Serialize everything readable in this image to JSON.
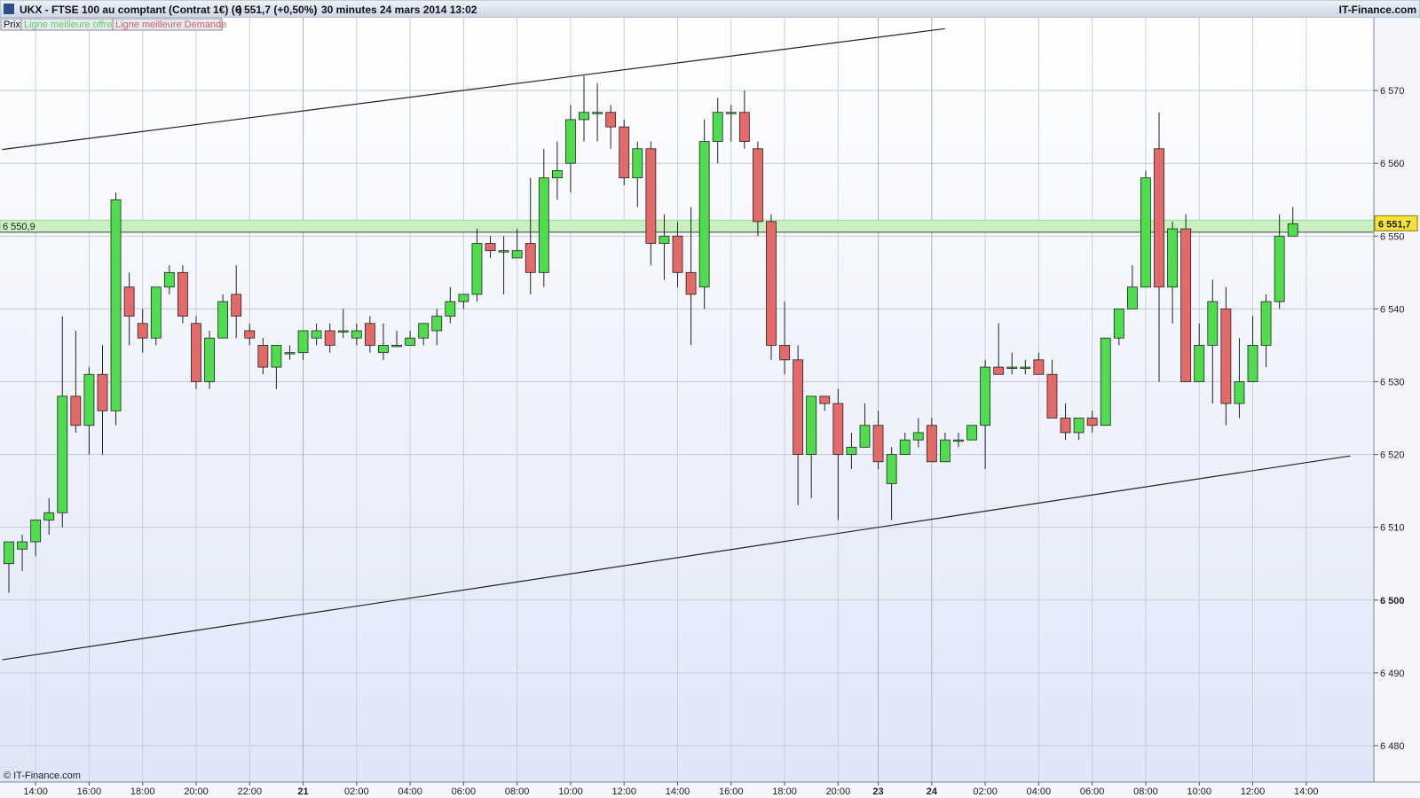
{
  "header": {
    "instrument": "UKX - FTSE 100 au comptant (Contrat 1€) (-)",
    "last": "6 551,7 (+0,50%)",
    "timeframe": "30 minutes",
    "datetime": "24 mars 2014 13:02",
    "brand": "IT-Finance.com"
  },
  "legend": {
    "prix": "Prix",
    "offre": "Ligne meilleure offre",
    "demande": "Ligne meilleure Demande"
  },
  "footer": {
    "copyright": "© IT-Finance.com"
  },
  "colors": {
    "up": "#4fdc4f",
    "down": "#e46a6a",
    "offre_text": "#5ccf5c",
    "demande_text": "#d86060",
    "band": "#c8f0c0",
    "last_tag": "#f5e23a"
  },
  "chart_data": {
    "type": "candlestick",
    "ylim": [
      6475,
      6580
    ],
    "yticks": [
      {
        "value": 6480,
        "label": "6 480"
      },
      {
        "value": 6490,
        "label": "6 490"
      },
      {
        "value": 6500,
        "label": "6 500",
        "bold": true
      },
      {
        "value": 6510,
        "label": "6 510"
      },
      {
        "value": 6520,
        "label": "6 520"
      },
      {
        "value": 6530,
        "label": "6 530"
      },
      {
        "value": 6540,
        "label": "6 540"
      },
      {
        "value": 6550,
        "label": "6 550"
      },
      {
        "value": 6560,
        "label": "6 560"
      },
      {
        "value": 6570,
        "label": "6 570"
      }
    ],
    "xticks": [
      {
        "i": 2,
        "label": "14:00"
      },
      {
        "i": 6,
        "label": "16:00"
      },
      {
        "i": 10,
        "label": "18:00"
      },
      {
        "i": 14,
        "label": "20:00"
      },
      {
        "i": 18,
        "label": "22:00"
      },
      {
        "i": 22,
        "label": "21",
        "bold": true
      },
      {
        "i": 26,
        "label": "02:00"
      },
      {
        "i": 30,
        "label": "04:00"
      },
      {
        "i": 34,
        "label": "06:00"
      },
      {
        "i": 38,
        "label": "08:00"
      },
      {
        "i": 42,
        "label": "10:00"
      },
      {
        "i": 46,
        "label": "12:00"
      },
      {
        "i": 50,
        "label": "14:00"
      },
      {
        "i": 54,
        "label": "16:00"
      },
      {
        "i": 58,
        "label": "18:00"
      },
      {
        "i": 62,
        "label": "20:00"
      },
      {
        "i": 65,
        "label": "23",
        "bold": true
      },
      {
        "i": 69,
        "label": "24",
        "bold": true
      },
      {
        "i": 73,
        "label": "02:00"
      },
      {
        "i": 77,
        "label": "04:00"
      },
      {
        "i": 81,
        "label": "06:00"
      },
      {
        "i": 85,
        "label": "08:00"
      },
      {
        "i": 89,
        "label": "10:00"
      },
      {
        "i": 93,
        "label": "12:00"
      },
      {
        "i": 97,
        "label": "14:00"
      }
    ],
    "price_line": {
      "value": 6550.9,
      "label": "6 550,9"
    },
    "last_price": {
      "value": 6551.7,
      "label": "6 551,7"
    },
    "band": [
      6550.9,
      6552.2
    ],
    "trendlines": [
      {
        "from": [
          -0.5,
          6561.9
        ],
        "to": [
          70,
          6578.5
        ]
      },
      {
        "from": [
          -0.5,
          6491.8
        ],
        "to": [
          100.3,
          6519.8
        ]
      }
    ],
    "candles": [
      [
        6505.0,
        6508.0,
        6501.0,
        6508.0
      ],
      [
        6507.0,
        6509.0,
        6504.0,
        6508.0
      ],
      [
        6508.0,
        6511.0,
        6506.0,
        6511.0
      ],
      [
        6511.0,
        6514.0,
        6509.0,
        6512.0
      ],
      [
        6512.0,
        6539.0,
        6510.0,
        6528.0
      ],
      [
        6528.0,
        6537.0,
        6523.0,
        6524.0
      ],
      [
        6524.0,
        6532.0,
        6520.0,
        6531.0
      ],
      [
        6531.0,
        6535.0,
        6520.0,
        6526.0
      ],
      [
        6526.0,
        6556.0,
        6524.0,
        6555.0
      ],
      [
        6543.0,
        6545.0,
        6535.0,
        6539.0
      ],
      [
        6538.0,
        6540.0,
        6534.0,
        6536.0
      ],
      [
        6536.0,
        6543.0,
        6535.0,
        6543.0
      ],
      [
        6543.0,
        6546.0,
        6542.0,
        6545.0
      ],
      [
        6545.0,
        6546.0,
        6538.0,
        6539.0
      ],
      [
        6538.0,
        6539.0,
        6529.0,
        6530.0
      ],
      [
        6530.0,
        6537.0,
        6529.0,
        6536.0
      ],
      [
        6536.0,
        6542.0,
        6536.0,
        6541.0
      ],
      [
        6542.0,
        6546.0,
        6536.0,
        6539.0
      ],
      [
        6537.0,
        6538.0,
        6535.0,
        6536.0
      ],
      [
        6535.0,
        6536.0,
        6531.0,
        6532.0
      ],
      [
        6532.0,
        6535.0,
        6529.0,
        6535.0
      ],
      [
        6534.0,
        6535.0,
        6533.0,
        6534.0
      ],
      [
        6534.0,
        6537.0,
        6533.0,
        6537.0
      ],
      [
        6536.0,
        6538.0,
        6535.0,
        6537.0
      ],
      [
        6537.0,
        6538.0,
        6534.0,
        6535.0
      ],
      [
        6537.0,
        6540.0,
        6536.0,
        6537.0
      ],
      [
        6536.0,
        6538.0,
        6535.0,
        6537.0
      ],
      [
        6538.0,
        6539.0,
        6534.0,
        6535.0
      ],
      [
        6534.0,
        6538.0,
        6533.0,
        6535.0
      ],
      [
        6535.0,
        6537.0,
        6535.0,
        6535.0
      ],
      [
        6535.0,
        6537.0,
        6535.0,
        6536.0
      ],
      [
        6536.0,
        6538.0,
        6535.0,
        6538.0
      ],
      [
        6537.0,
        6540.0,
        6535.0,
        6539.0
      ],
      [
        6539.0,
        6543.0,
        6538.0,
        6541.0
      ],
      [
        6541.0,
        6542.0,
        6540.0,
        6542.0
      ],
      [
        6542.0,
        6551.0,
        6541.0,
        6549.0
      ],
      [
        6549.0,
        6550.0,
        6547.0,
        6548.0
      ],
      [
        6548.0,
        6550.0,
        6542.0,
        6548.0
      ],
      [
        6547.0,
        6551.0,
        6547.0,
        6548.0
      ],
      [
        6549.0,
        6558.0,
        6542.0,
        6545.0
      ],
      [
        6545.0,
        6562.0,
        6543.0,
        6558.0
      ],
      [
        6558.0,
        6563.0,
        6555.0,
        6559.0
      ],
      [
        6560.0,
        6568.0,
        6556.0,
        6566.0
      ],
      [
        6566.0,
        6572.0,
        6563.0,
        6567.0
      ],
      [
        6567.0,
        6571.0,
        6563.0,
        6567.0
      ],
      [
        6567.0,
        6568.0,
        6562.0,
        6565.0
      ],
      [
        6565.0,
        6566.0,
        6557.0,
        6558.0
      ],
      [
        6558.0,
        6563.0,
        6554.0,
        6562.0
      ],
      [
        6562.0,
        6563.0,
        6546.0,
        6549.0
      ],
      [
        6549.0,
        6553.0,
        6544.0,
        6550.0
      ],
      [
        6550.0,
        6552.0,
        6543.0,
        6545.0
      ],
      [
        6545.0,
        6554.0,
        6535.0,
        6542.0
      ],
      [
        6543.0,
        6566.0,
        6540.0,
        6563.0
      ],
      [
        6563.0,
        6569.0,
        6560.0,
        6567.0
      ],
      [
        6567.0,
        6568.0,
        6563.0,
        6567.0
      ],
      [
        6567.0,
        6570.0,
        6562.0,
        6563.0
      ],
      [
        6562.0,
        6563.0,
        6550.0,
        6552.0
      ],
      [
        6552.0,
        6553.0,
        6533.0,
        6535.0
      ],
      [
        6535.0,
        6541.0,
        6531.0,
        6533.0
      ],
      [
        6533.0,
        6535.0,
        6513.0,
        6520.0
      ],
      [
        6520.0,
        6528.0,
        6514.0,
        6528.0
      ],
      [
        6528.0,
        6528.0,
        6526.0,
        6527.0
      ],
      [
        6527.0,
        6529.0,
        6511.0,
        6520.0
      ],
      [
        6520.0,
        6523.0,
        6518.0,
        6521.0
      ],
      [
        6521.0,
        6527.0,
        6521.0,
        6524.0
      ],
      [
        6524.0,
        6526.0,
        6518.0,
        6519.0
      ],
      [
        6516.0,
        6521.0,
        6511.0,
        6520.0
      ],
      [
        6520.0,
        6523.0,
        6520.0,
        6522.0
      ],
      [
        6522.0,
        6525.0,
        6521.0,
        6523.0
      ],
      [
        6524.0,
        6525.0,
        6519.0,
        6519.0
      ],
      [
        6519.0,
        6523.0,
        6519.0,
        6522.0
      ],
      [
        6522.0,
        6523.0,
        6521.0,
        6522.0
      ],
      [
        6522.0,
        6524.0,
        6522.0,
        6524.0
      ],
      [
        6524.0,
        6533.0,
        6518.0,
        6532.0
      ],
      [
        6532.0,
        6538.0,
        6531.0,
        6531.0
      ],
      [
        6532.0,
        6534.0,
        6531.0,
        6532.0
      ],
      [
        6532.0,
        6533.0,
        6531.0,
        6532.0
      ],
      [
        6533.0,
        6534.0,
        6531.0,
        6531.0
      ],
      [
        6531.0,
        6533.0,
        6525.0,
        6525.0
      ],
      [
        6525.0,
        6527.0,
        6522.0,
        6523.0
      ],
      [
        6523.0,
        6525.0,
        6522.0,
        6525.0
      ],
      [
        6525.0,
        6526.0,
        6523.0,
        6524.0
      ],
      [
        6524.0,
        6536.0,
        6524.0,
        6536.0
      ],
      [
        6536.0,
        6540.0,
        6535.0,
        6540.0
      ],
      [
        6540.0,
        6546.0,
        6541.0,
        6543.0
      ],
      [
        6543.0,
        6559.0,
        6544.0,
        6558.0
      ],
      [
        6562.0,
        6567.0,
        6530.0,
        6543.0
      ],
      [
        6543.0,
        6552.0,
        6538.0,
        6551.0
      ],
      [
        6551.0,
        6553.0,
        6530.0,
        6530.0
      ],
      [
        6530.0,
        6538.0,
        6530.0,
        6535.0
      ],
      [
        6535.0,
        6544.0,
        6527.0,
        6541.0
      ],
      [
        6540.0,
        6543.0,
        6524.0,
        6527.0
      ],
      [
        6527.0,
        6536.0,
        6525.0,
        6530.0
      ],
      [
        6530.0,
        6539.0,
        6530.0,
        6535.0
      ],
      [
        6535.0,
        6542.0,
        6532.0,
        6541.0
      ],
      [
        6541.0,
        6553.0,
        6540.0,
        6550.0
      ],
      [
        6550.0,
        6554.0,
        6550.0,
        6551.7
      ]
    ]
  }
}
